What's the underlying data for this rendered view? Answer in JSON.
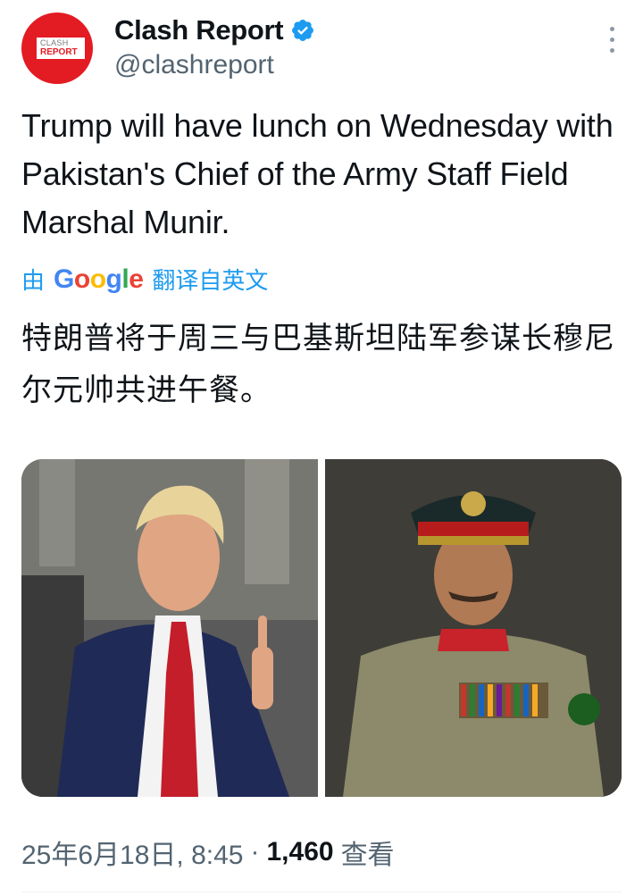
{
  "author": {
    "display_name": "Clash Report",
    "handle": "@clashreport",
    "verified": true,
    "avatar_text_top": "CLASH",
    "avatar_text_bottom": "REPORT",
    "avatar_color": "#e31b23"
  },
  "tweet": {
    "text": "Trump will have lunch on Wednesday with Pakistan's Chief of the Army Staff Field Marshal Munir.",
    "translation_prefix": "由",
    "translation_provider": "Google",
    "translation_suffix": "翻译自英文",
    "translated_text": "特朗普将于周三与巴基斯坦陆军参谋长穆尼尔元帅共进午餐。"
  },
  "media": {
    "left_image": "photo-trump",
    "right_image": "photo-munir"
  },
  "meta": {
    "timestamp": "25年6月18日, 8:45",
    "separator": "·",
    "views_count": "1,460",
    "views_label": "查看"
  },
  "colors": {
    "link_blue": "#1d9bf0",
    "secondary_text": "#536471",
    "primary_text": "#0f1419"
  }
}
